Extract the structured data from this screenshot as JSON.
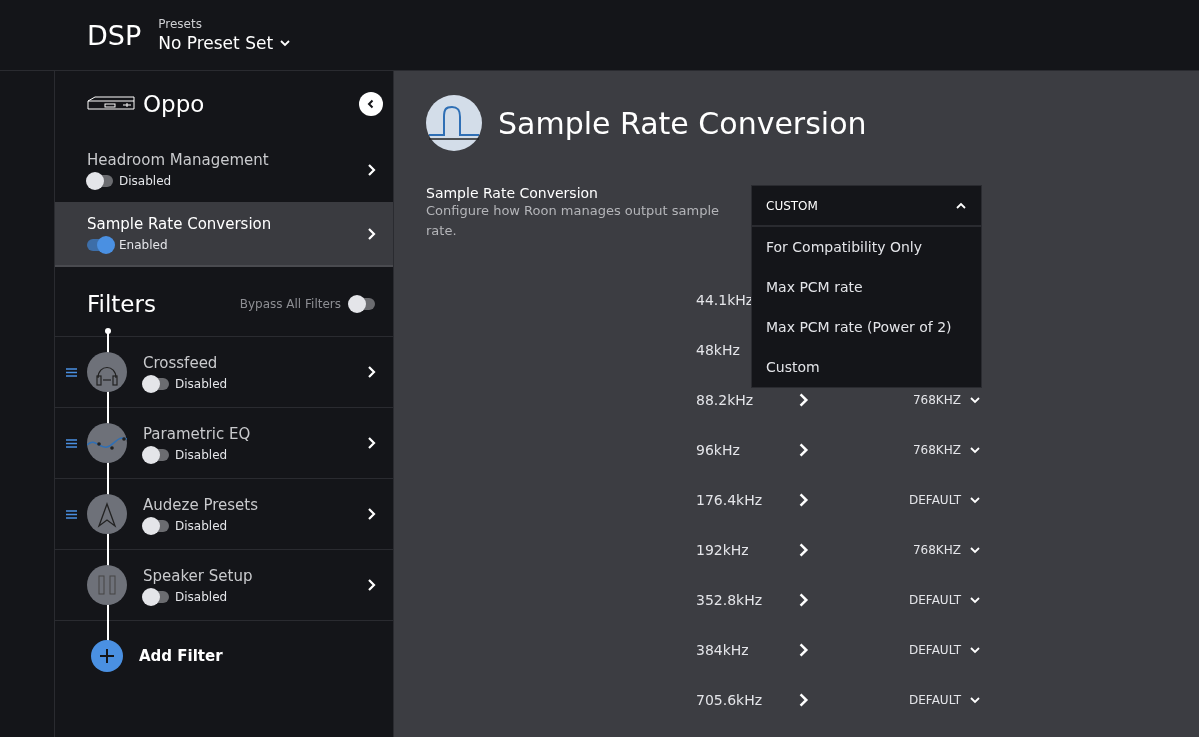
{
  "header": {
    "app_title": "DSP",
    "presets_label": "Presets",
    "preset_value": "No Preset Set"
  },
  "sidebar": {
    "device": "Oppo",
    "sections": [
      {
        "title": "Headroom Management",
        "on": false,
        "status": "Disabled",
        "selected": false
      },
      {
        "title": "Sample Rate Conversion",
        "on": true,
        "status": "Enabled",
        "selected": true
      }
    ],
    "filters_title": "Filters",
    "bypass_label": "Bypass All Filters",
    "bypass_on": false,
    "filters": [
      {
        "kind": "crossfeed",
        "name": "Crossfeed",
        "on": false,
        "status": "Disabled",
        "draggable": true
      },
      {
        "kind": "eq",
        "name": "Parametric EQ",
        "on": false,
        "status": "Disabled",
        "draggable": true
      },
      {
        "kind": "audeze",
        "name": "Audeze Presets",
        "on": false,
        "status": "Disabled",
        "draggable": true
      },
      {
        "kind": "speaker",
        "name": "Speaker Setup",
        "on": false,
        "status": "Disabled",
        "draggable": false
      }
    ],
    "add_filter": "Add Filter"
  },
  "main": {
    "title": "Sample Rate Conversion",
    "setting_label": "Sample Rate Conversion",
    "setting_description": "Configure how Roon manages output sample rate.",
    "dropdown": {
      "value": "CUSTOM",
      "expanded": true,
      "options": [
        "For Compatibility Only",
        "Max PCM rate",
        "Max PCM rate (Power of 2)",
        "Custom"
      ]
    },
    "rates": [
      {
        "rate": "44.1kHz"
      },
      {
        "rate": "48kHz"
      },
      {
        "rate": "88.2kHz",
        "value": "768KHZ"
      },
      {
        "rate": "96kHz",
        "value": "768KHZ"
      },
      {
        "rate": "176.4kHz",
        "value": "DEFAULT"
      },
      {
        "rate": "192kHz",
        "value": "768KHZ"
      },
      {
        "rate": "352.8kHz",
        "value": "DEFAULT"
      },
      {
        "rate": "384kHz",
        "value": "DEFAULT"
      },
      {
        "rate": "705.6kHz",
        "value": "DEFAULT"
      }
    ]
  }
}
